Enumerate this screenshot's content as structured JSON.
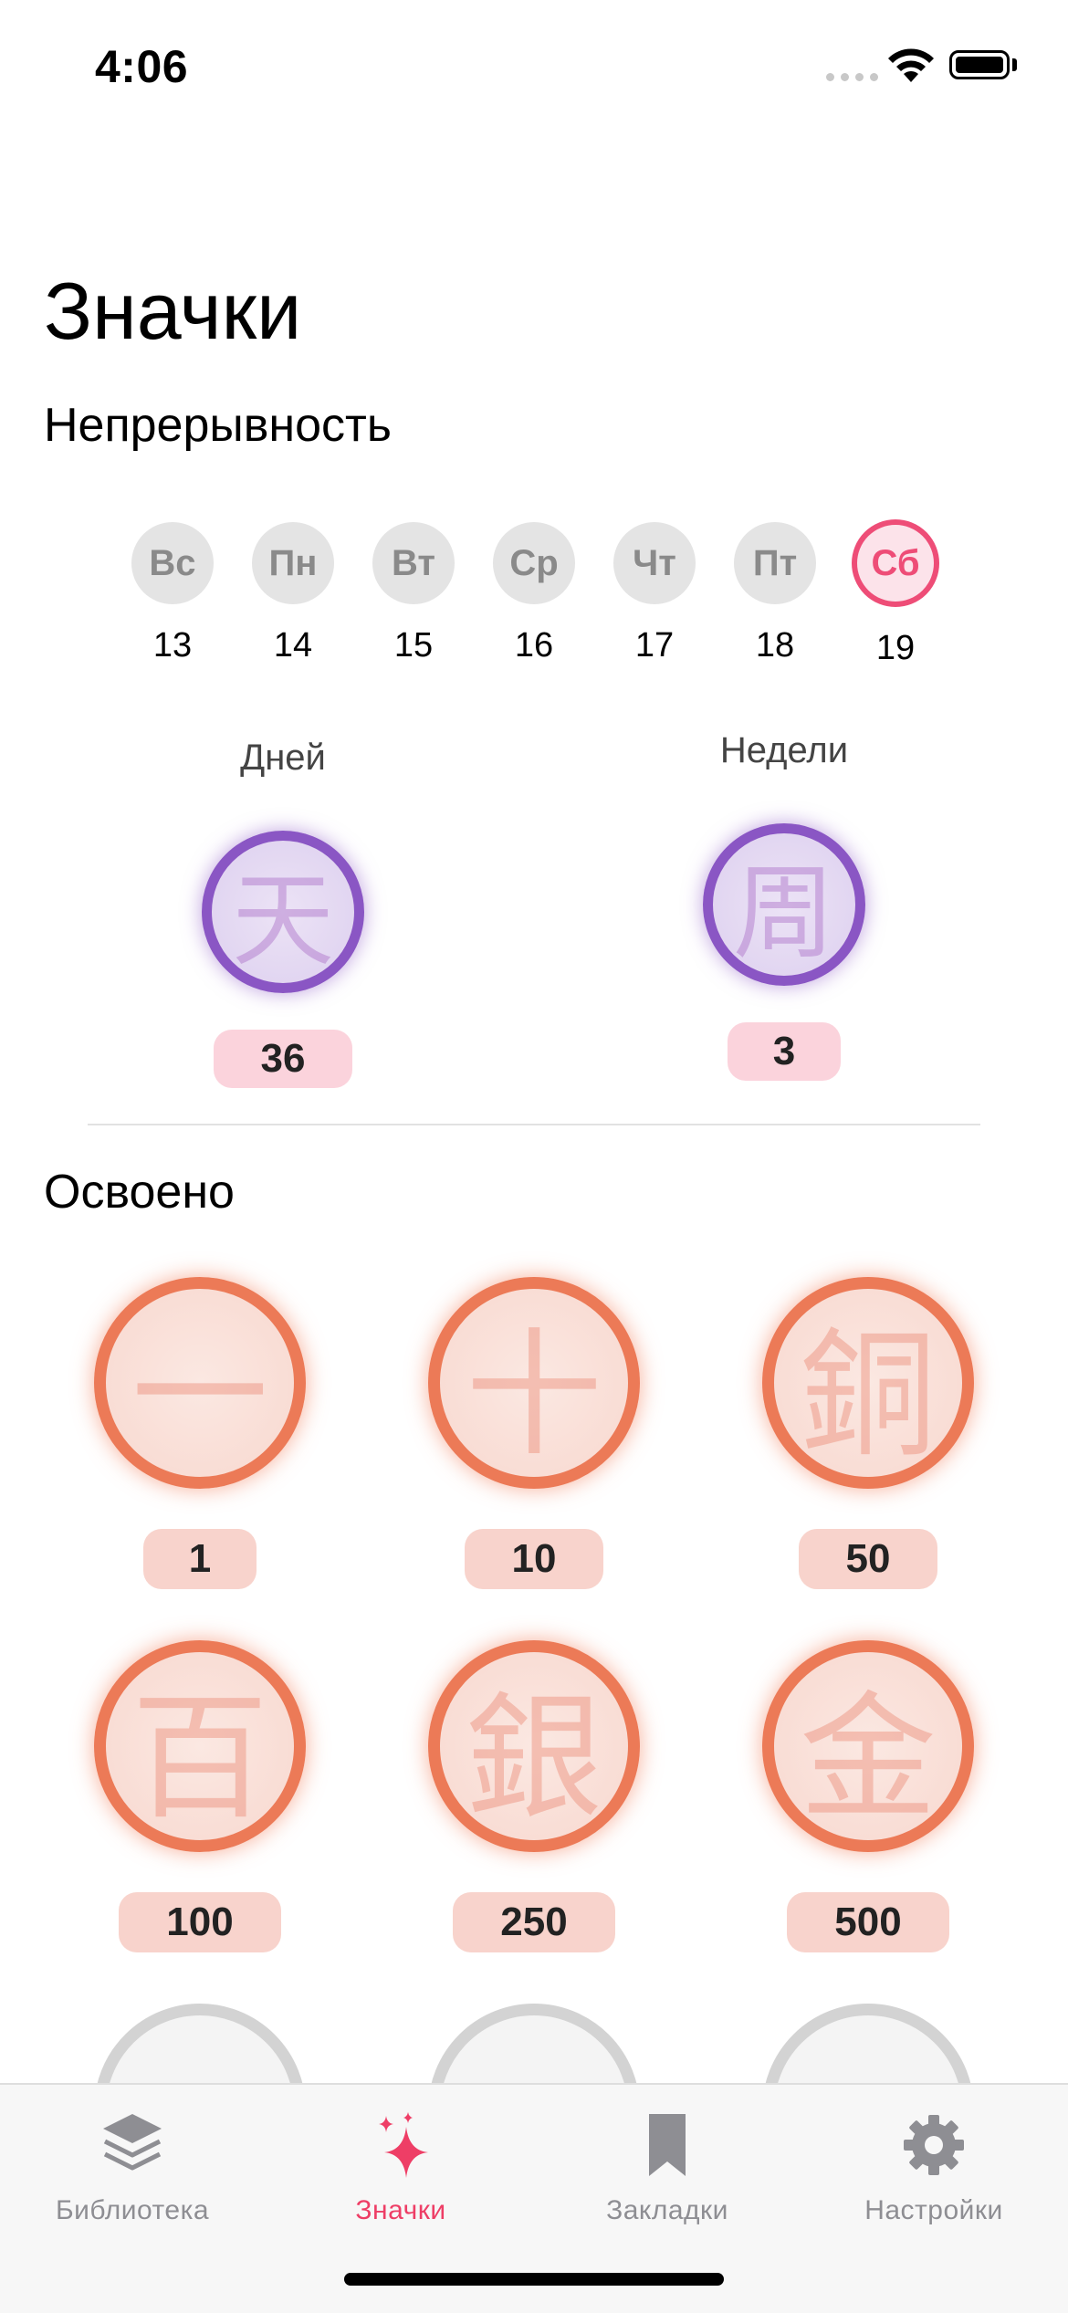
{
  "status_bar": {
    "time": "4:06"
  },
  "page_title": "Значки",
  "streak": {
    "title": "Непрерывность",
    "days": [
      {
        "label": "Вс",
        "num": "13",
        "active": false
      },
      {
        "label": "Пн",
        "num": "14",
        "active": false
      },
      {
        "label": "Вт",
        "num": "15",
        "active": false
      },
      {
        "label": "Ср",
        "num": "16",
        "active": false
      },
      {
        "label": "Чт",
        "num": "17",
        "active": false
      },
      {
        "label": "Пт",
        "num": "18",
        "active": false
      },
      {
        "label": "Сб",
        "num": "19",
        "active": true
      }
    ],
    "days_badge": {
      "label": "Дней",
      "glyph": "天",
      "count": "36"
    },
    "weeks_badge": {
      "label": "Недели",
      "glyph": "周",
      "count": "3"
    }
  },
  "mastered": {
    "title": "Освоено",
    "badges": [
      {
        "glyph": "一",
        "count": "1"
      },
      {
        "glyph": "十",
        "count": "10"
      },
      {
        "glyph": "銅",
        "count": "50"
      },
      {
        "glyph": "百",
        "count": "100"
      },
      {
        "glyph": "銀",
        "count": "250"
      },
      {
        "glyph": "金",
        "count": "500"
      }
    ]
  },
  "tabs": [
    {
      "label": "Библиотека",
      "icon": "layers-icon"
    },
    {
      "label": "Значки",
      "icon": "sparkles-icon",
      "active": true
    },
    {
      "label": "Закладки",
      "icon": "bookmark-icon"
    },
    {
      "label": "Настройки",
      "icon": "gear-icon"
    }
  ],
  "colors": {
    "accent": "#ee3e66",
    "streak_purple": "#8a56c4",
    "mastered_orange": "#ec7a57",
    "pill_pink": "#fbd3dc",
    "pill_peach": "#f8d3cc"
  }
}
